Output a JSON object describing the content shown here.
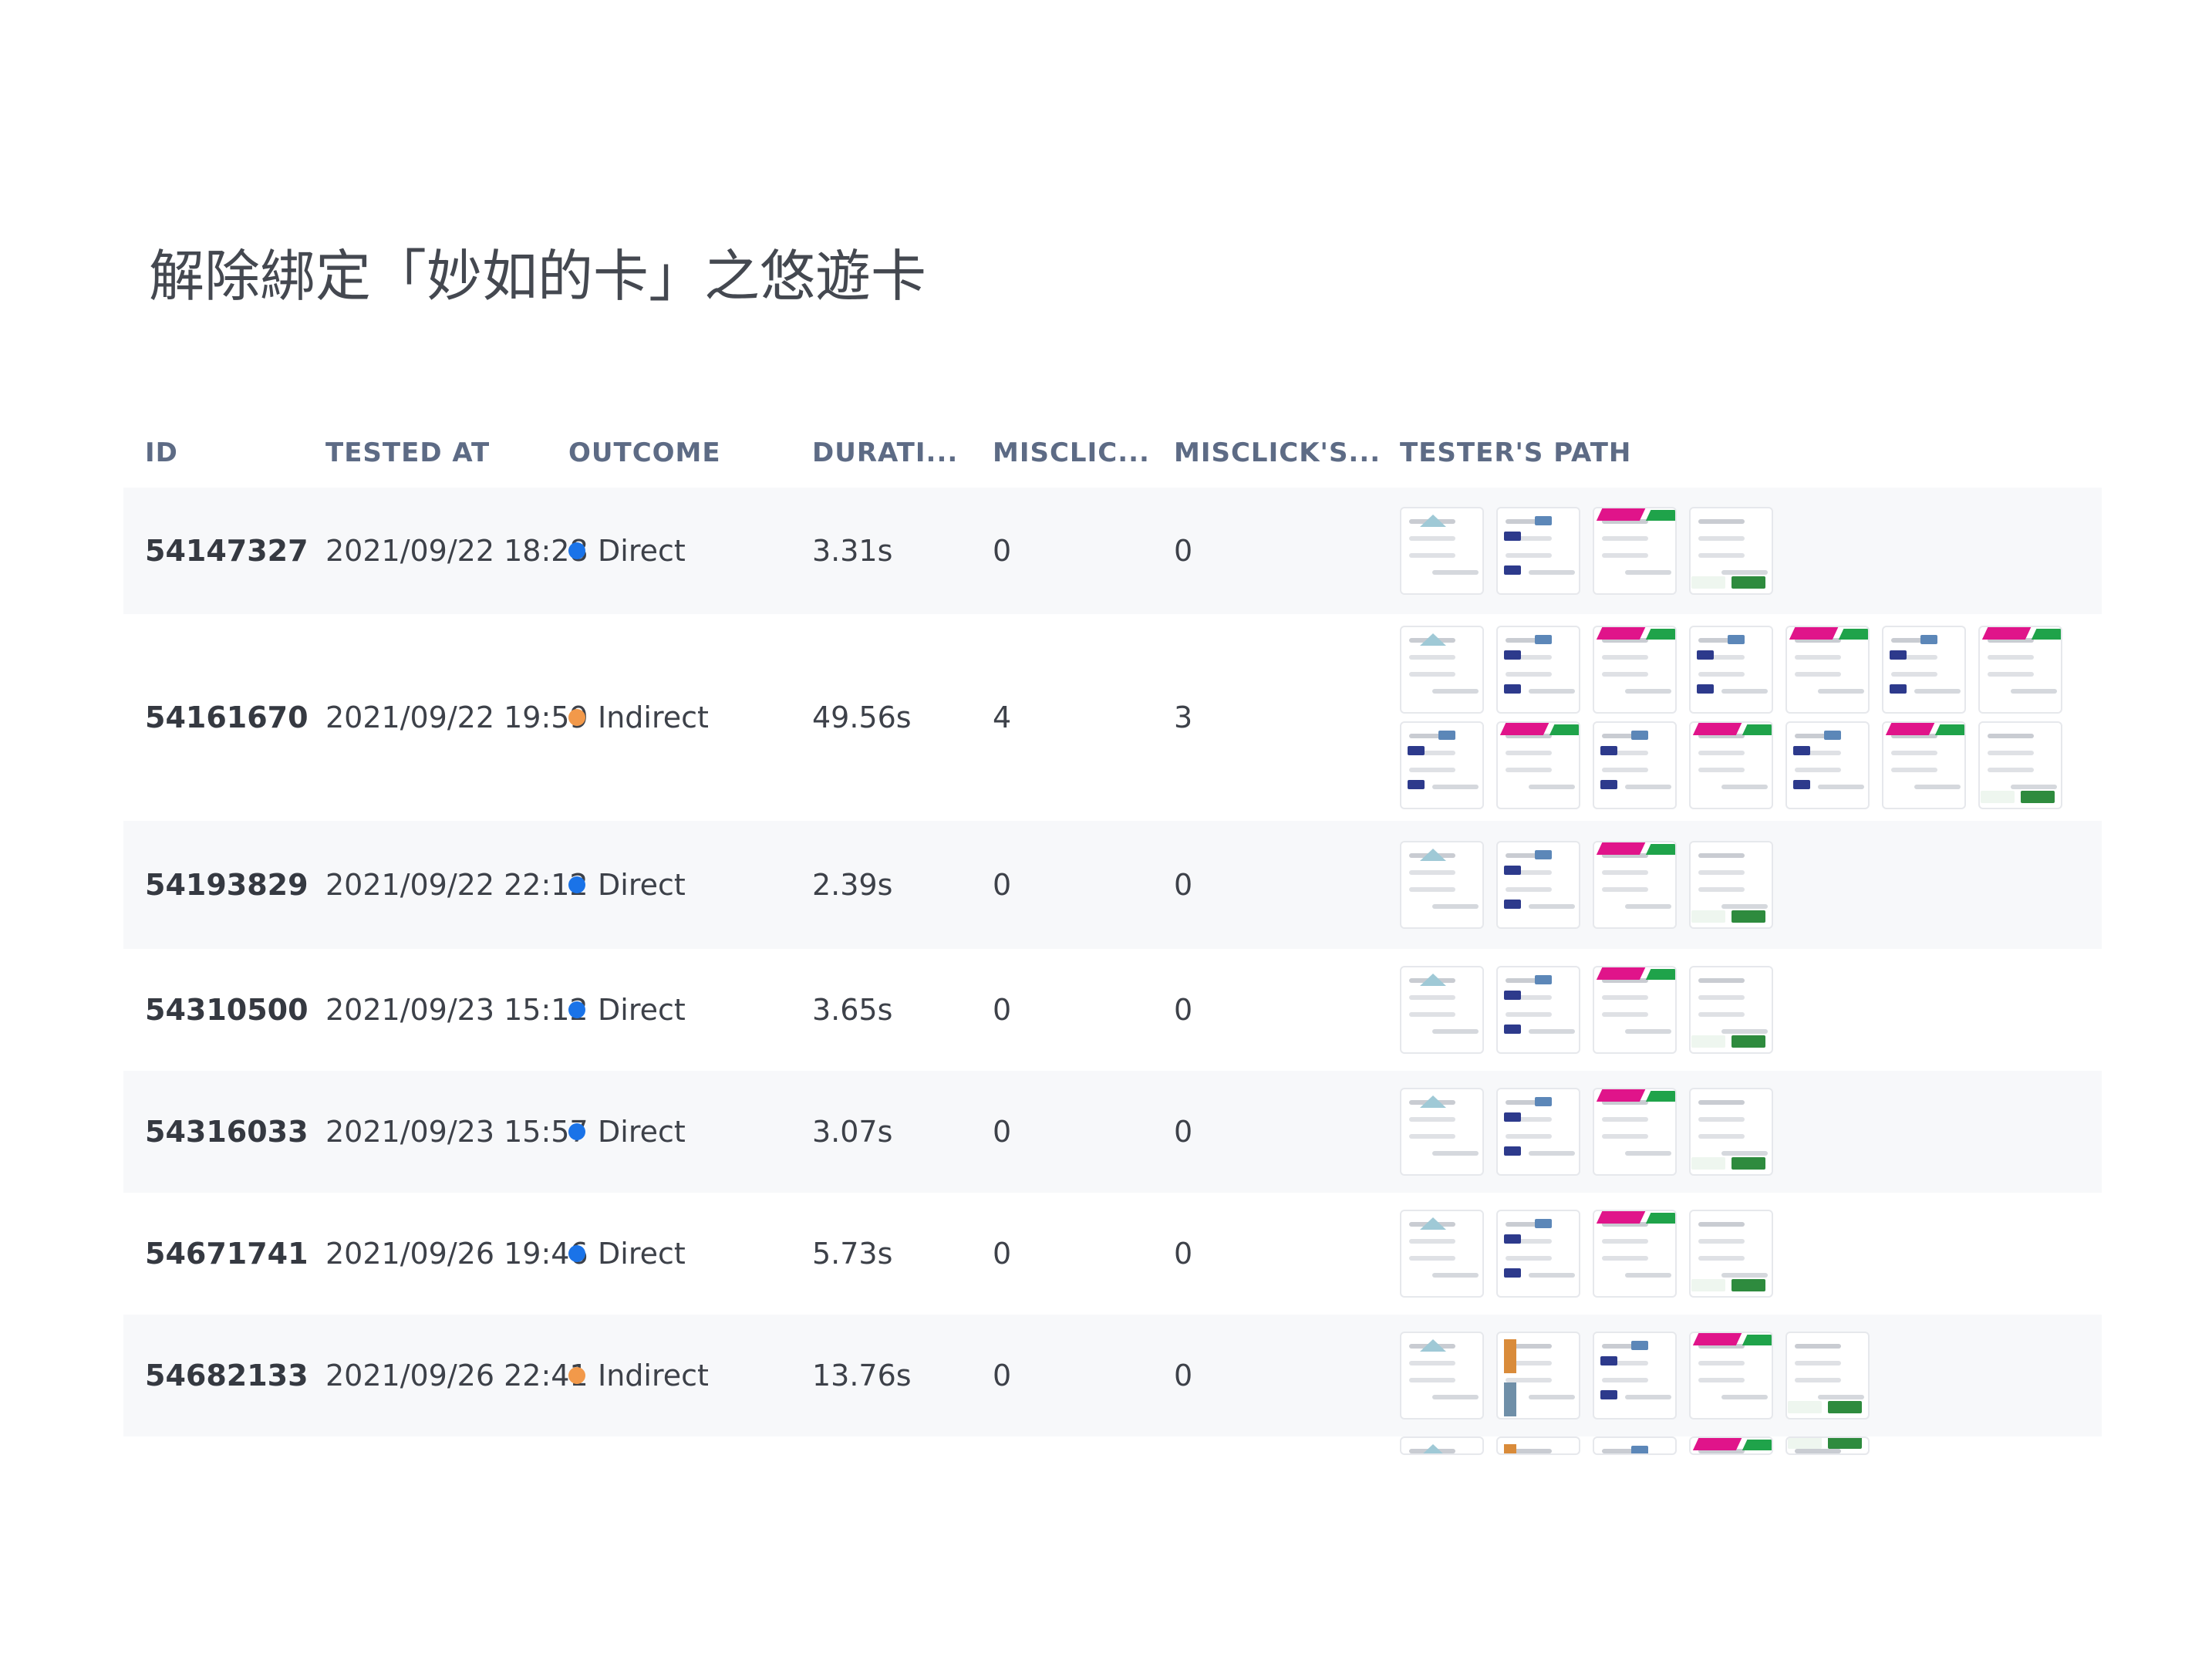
{
  "page": {
    "title": "解除綁定「妙如的卡」之悠遊卡"
  },
  "table": {
    "columns": {
      "id": "ID",
      "tested_at": "TESTED AT",
      "outcome": "OUTCOME",
      "duration": "DURATI...",
      "misclicks": "MISCLIC...",
      "misclick_screens": "MISCLICK'S...",
      "path": "TESTER'S PATH"
    },
    "outcome_colors": {
      "Direct": "#1a73e8",
      "Indirect": "#f2994a"
    },
    "rows": [
      {
        "id": "54147327",
        "tested_at": "2021/09/22 18:28",
        "outcome": "Direct",
        "duration": "3.31s",
        "misclicks": "0",
        "misclick_screens": "0",
        "path_screens": [
          [
            "home-screen",
            "card-list-screen",
            "card-detail-screen",
            "confirm-dialog-screen"
          ]
        ]
      },
      {
        "id": "54161670",
        "tested_at": "2021/09/22 19:59",
        "outcome": "Indirect",
        "duration": "49.56s",
        "misclicks": "4",
        "misclick_screens": "3",
        "path_screens": [
          [
            "home-screen",
            "card-list-screen",
            "card-detail-screen",
            "card-list-screen",
            "card-detail-screen",
            "card-list-screen",
            "card-detail-screen"
          ],
          [
            "card-list-screen",
            "card-detail-screen",
            "card-list-screen",
            "card-detail-screen",
            "card-list-screen",
            "card-detail-screen",
            "confirm-dialog-screen"
          ]
        ]
      },
      {
        "id": "54193829",
        "tested_at": "2021/09/22 22:12",
        "outcome": "Direct",
        "duration": "2.39s",
        "misclicks": "0",
        "misclick_screens": "0",
        "path_screens": [
          [
            "home-screen",
            "card-list-screen",
            "card-detail-screen",
            "confirm-dialog-screen"
          ]
        ]
      },
      {
        "id": "54310500",
        "tested_at": "2021/09/23 15:12",
        "outcome": "Direct",
        "duration": "3.65s",
        "misclicks": "0",
        "misclick_screens": "0",
        "path_screens": [
          [
            "home-screen",
            "card-list-screen",
            "card-detail-screen",
            "confirm-dialog-screen"
          ]
        ]
      },
      {
        "id": "54316033",
        "tested_at": "2021/09/23 15:57",
        "outcome": "Direct",
        "duration": "3.07s",
        "misclicks": "0",
        "misclick_screens": "0",
        "path_screens": [
          [
            "home-screen",
            "card-list-screen",
            "card-detail-screen",
            "confirm-dialog-screen"
          ]
        ]
      },
      {
        "id": "54671741",
        "tested_at": "2021/09/26 19:46",
        "outcome": "Direct",
        "duration": "5.73s",
        "misclicks": "0",
        "misclick_screens": "0",
        "path_screens": [
          [
            "home-screen",
            "card-list-screen",
            "card-detail-screen",
            "confirm-dialog-screen"
          ]
        ]
      },
      {
        "id": "54682133",
        "tested_at": "2021/09/26 22:41",
        "outcome": "Indirect",
        "duration": "13.76s",
        "misclicks": "0",
        "misclick_screens": "0",
        "path_screens": [
          [
            "home-screen",
            "promo-screen",
            "card-list-screen",
            "card-detail-screen",
            "confirm-dialog-screen"
          ]
        ]
      }
    ]
  }
}
